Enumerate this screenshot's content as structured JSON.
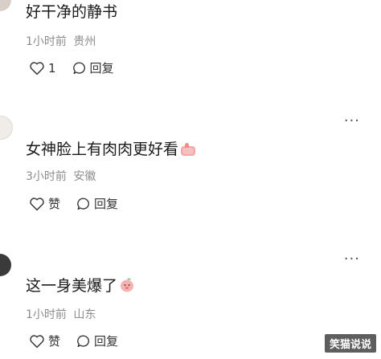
{
  "comments": [
    {
      "text": "好干净的静书",
      "time": "1小时前",
      "location": "贵州",
      "like_label": "1",
      "reply_label": "回复"
    },
    {
      "text": "女神脸上有肉肉更好看",
      "time": "3小时前",
      "location": "安徽",
      "like_label": "赞",
      "reply_label": "回复",
      "emoji": "thumbs-up-icon"
    },
    {
      "text": "这一身美爆了",
      "time": "1小时前",
      "location": "山东",
      "like_label": "赞",
      "reply_label": "回复",
      "emoji": "peach-face-icon"
    }
  ],
  "more_label": "···",
  "watermark": "笑猫说说"
}
